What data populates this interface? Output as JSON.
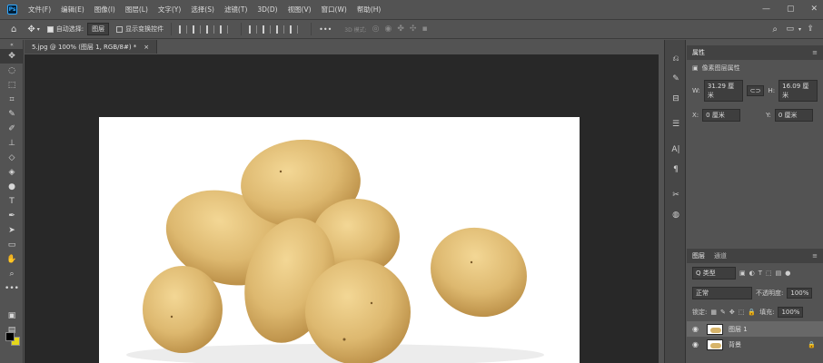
{
  "app": {
    "logo": "Ps",
    "menus": [
      "文件(F)",
      "编辑(E)",
      "图像(I)",
      "图层(L)",
      "文字(Y)",
      "选择(S)",
      "滤镜(T)",
      "3D(D)",
      "视图(V)",
      "窗口(W)",
      "帮助(H)"
    ],
    "window_controls": [
      "—",
      "▢",
      "✕"
    ]
  },
  "options_bar": {
    "auto_select_label": "自动选择:",
    "auto_select_value": "图层",
    "show_transform_label": "显示变换控件",
    "mode_3d_label": "3D 模式:",
    "more": "•••"
  },
  "document": {
    "tab_title": "5.jpg @ 100% (图层 1, RGB/8#) *",
    "close": "×"
  },
  "properties": {
    "title": "属性",
    "subtitle": "像素图层属性",
    "w_label": "W:",
    "w_value": "31.29 厘米",
    "h_label": "H:",
    "h_value": "16.09 厘米",
    "x_label": "X:",
    "x_value": "0 厘米",
    "y_label": "Y:",
    "y_value": "0 厘米"
  },
  "layers": {
    "tabs": [
      "图层",
      "通道"
    ],
    "filter_kind": "Q 类型",
    "blend_mode": "正常",
    "opacity_label": "不透明度:",
    "opacity_value": "100%",
    "lock_label": "锁定:",
    "fill_label": "填充:",
    "fill_value": "100%",
    "items": [
      {
        "name": "图层 1",
        "selected": true
      },
      {
        "name": "背景",
        "selected": false
      }
    ]
  },
  "colors": {
    "ui_bg": "#535353",
    "canvas_bg": "#282828",
    "accent": "#31a8ff",
    "background_swatch": "#e6d81a",
    "foreground_swatch": "#000000",
    "potato": "#d8b56b"
  }
}
